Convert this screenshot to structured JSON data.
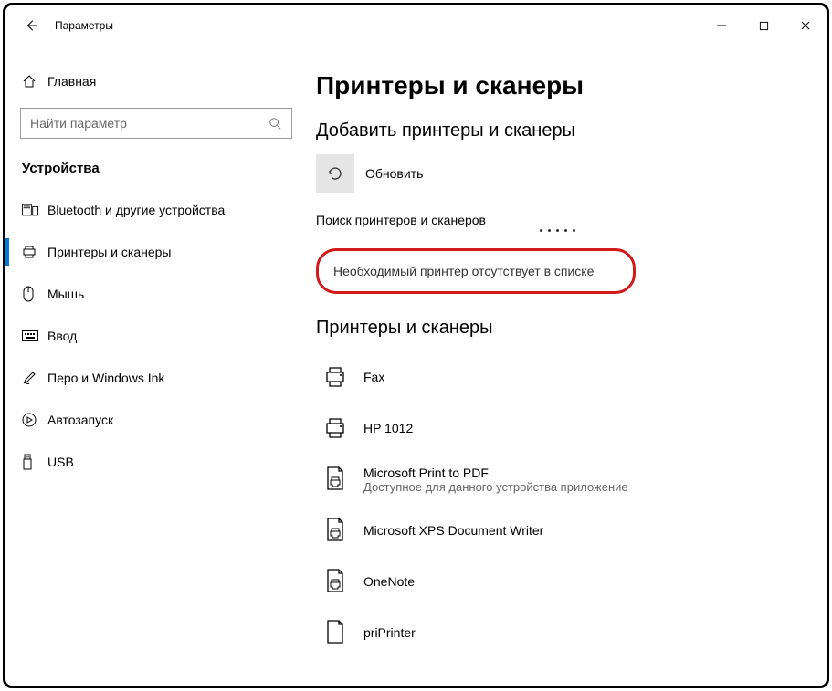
{
  "window": {
    "title": "Параметры"
  },
  "sidebar": {
    "home": "Главная",
    "search_placeholder": "Найти параметр",
    "category": "Устройства",
    "items": [
      {
        "label": "Bluetooth и другие устройства"
      },
      {
        "label": "Принтеры и сканеры"
      },
      {
        "label": "Мышь"
      },
      {
        "label": "Ввод"
      },
      {
        "label": "Перо и Windows Ink"
      },
      {
        "label": "Автозапуск"
      },
      {
        "label": "USB"
      }
    ]
  },
  "main": {
    "title": "Принтеры и сканеры",
    "add_section": "Добавить принтеры и сканеры",
    "refresh": "Обновить",
    "searching": "Поиск принтеров и сканеров",
    "missing_link": "Необходимый принтер отсутствует в списке",
    "list_section": "Принтеры и сканеры",
    "devices": [
      {
        "name": "Fax",
        "sub": ""
      },
      {
        "name": "HP 1012",
        "sub": ""
      },
      {
        "name": "Microsoft Print to PDF",
        "sub": "Доступное для данного устройства приложение"
      },
      {
        "name": "Microsoft XPS Document Writer",
        "sub": ""
      },
      {
        "name": "OneNote",
        "sub": ""
      },
      {
        "name": "priPrinter",
        "sub": ""
      }
    ]
  }
}
